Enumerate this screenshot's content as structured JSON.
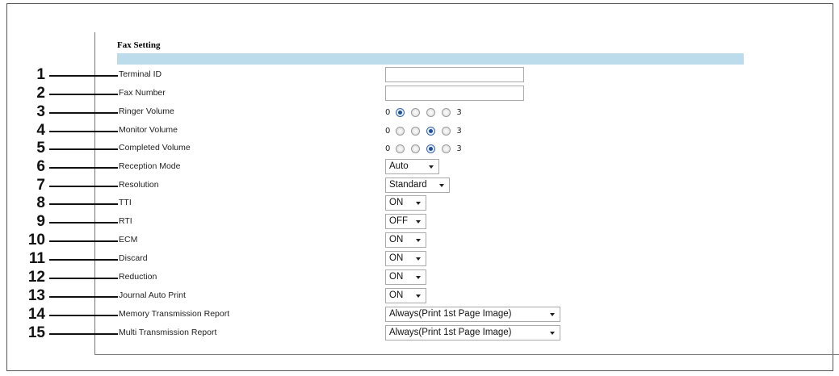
{
  "section_title": "Fax Setting",
  "rows": [
    {
      "num": "1",
      "label": "Terminal ID",
      "control": {
        "kind": "text",
        "value": ""
      }
    },
    {
      "num": "2",
      "label": "Fax Number",
      "control": {
        "kind": "text",
        "value": ""
      }
    },
    {
      "num": "3",
      "label": "Ringer Volume",
      "control": {
        "kind": "radio",
        "min": "0",
        "max": "3",
        "selected": 0
      }
    },
    {
      "num": "4",
      "label": "Monitor Volume",
      "control": {
        "kind": "radio",
        "min": "0",
        "max": "3",
        "selected": 2
      }
    },
    {
      "num": "5",
      "label": "Completed Volume",
      "control": {
        "kind": "radio",
        "min": "0",
        "max": "3",
        "selected": 2
      }
    },
    {
      "num": "6",
      "label": "Reception Mode",
      "control": {
        "kind": "select",
        "value": "Auto"
      }
    },
    {
      "num": "7",
      "label": "Resolution",
      "control": {
        "kind": "select",
        "value": "Standard"
      }
    },
    {
      "num": "8",
      "label": "TTI",
      "control": {
        "kind": "select",
        "value": "ON"
      }
    },
    {
      "num": "9",
      "label": "RTI",
      "control": {
        "kind": "select",
        "value": "OFF"
      }
    },
    {
      "num": "10",
      "label": "ECM",
      "control": {
        "kind": "select",
        "value": "ON"
      }
    },
    {
      "num": "11",
      "label": "Discard",
      "control": {
        "kind": "select",
        "value": "ON"
      }
    },
    {
      "num": "12",
      "label": "Reduction",
      "control": {
        "kind": "select",
        "value": "ON"
      }
    },
    {
      "num": "13",
      "label": "Journal Auto Print",
      "control": {
        "kind": "select",
        "value": "ON"
      }
    },
    {
      "num": "14",
      "label": "Memory Transmission Report",
      "control": {
        "kind": "select",
        "value": "Always(Print 1st Page Image)"
      }
    },
    {
      "num": "15",
      "label": "Multi Transmission Report",
      "control": {
        "kind": "select",
        "value": "Always(Print 1st Page Image)"
      }
    }
  ],
  "colors": {
    "title_band": "#bcdcec",
    "radio_checked": "#1f4f9a"
  }
}
